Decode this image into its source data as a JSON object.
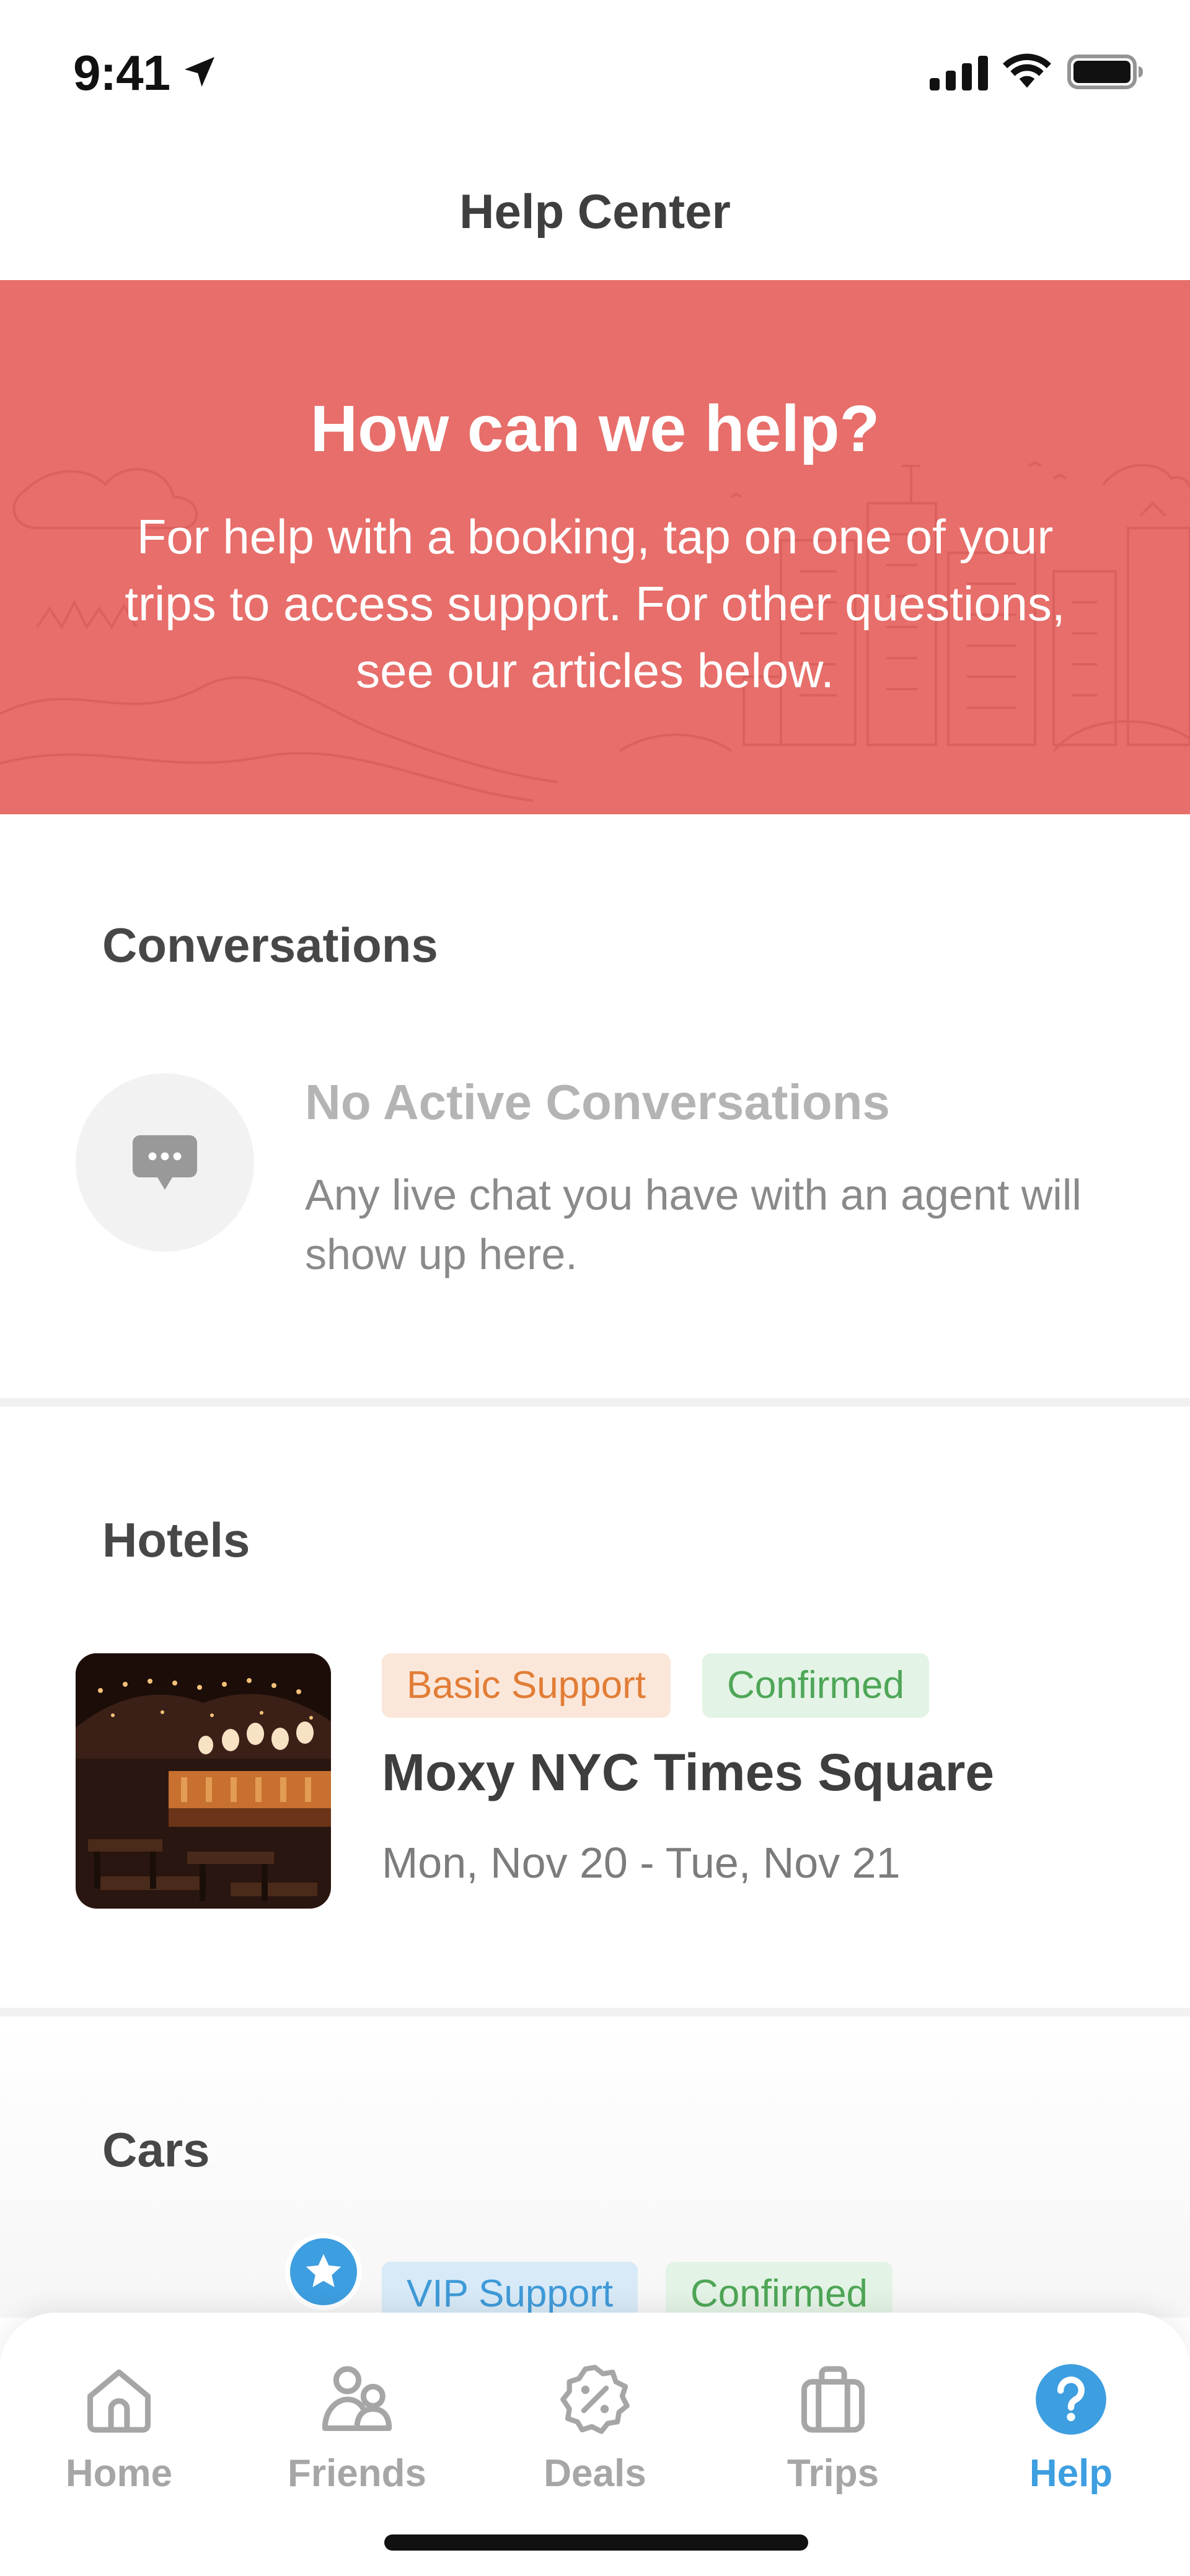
{
  "status_bar": {
    "time": "9:41",
    "icons": [
      "location-arrow-icon",
      "cellular-signal-icon",
      "wifi-icon",
      "battery-icon"
    ]
  },
  "header": {
    "title": "Help Center"
  },
  "hero": {
    "title": "How can we help?",
    "body": "For help with a booking, tap on one of your trips to access support. For other questions, see our articles below."
  },
  "conversations": {
    "section_title": "Conversations",
    "empty_title": "No Active Conversations",
    "empty_body": "Any live chat you have with an agent will show up here.",
    "icon": "chat-bubble-icon"
  },
  "hotels": {
    "section_title": "Hotels",
    "items": [
      {
        "badges": [
          "Basic Support",
          "Confirmed"
        ],
        "name": "Moxy NYC Times Square",
        "dates": "Mon, Nov 20 - Tue, Nov 21"
      }
    ]
  },
  "cars": {
    "section_title": "Cars",
    "items": [
      {
        "badges": [
          "VIP Support",
          "Confirmed"
        ],
        "icon": "star-icon"
      }
    ]
  },
  "tab_bar": {
    "tabs": [
      {
        "label": "Home",
        "icon": "home-icon",
        "active": false
      },
      {
        "label": "Friends",
        "icon": "friends-icon",
        "active": false
      },
      {
        "label": "Deals",
        "icon": "deals-badge-icon",
        "active": false
      },
      {
        "label": "Trips",
        "icon": "suitcase-icon",
        "active": false
      },
      {
        "label": "Help",
        "icon": "question-circle-icon",
        "active": true
      }
    ]
  },
  "colors": {
    "hero_bg": "#e76e6a",
    "accent_blue": "#3d9ee0",
    "basic_support": "#e27d36",
    "confirmed": "#4ea657"
  }
}
